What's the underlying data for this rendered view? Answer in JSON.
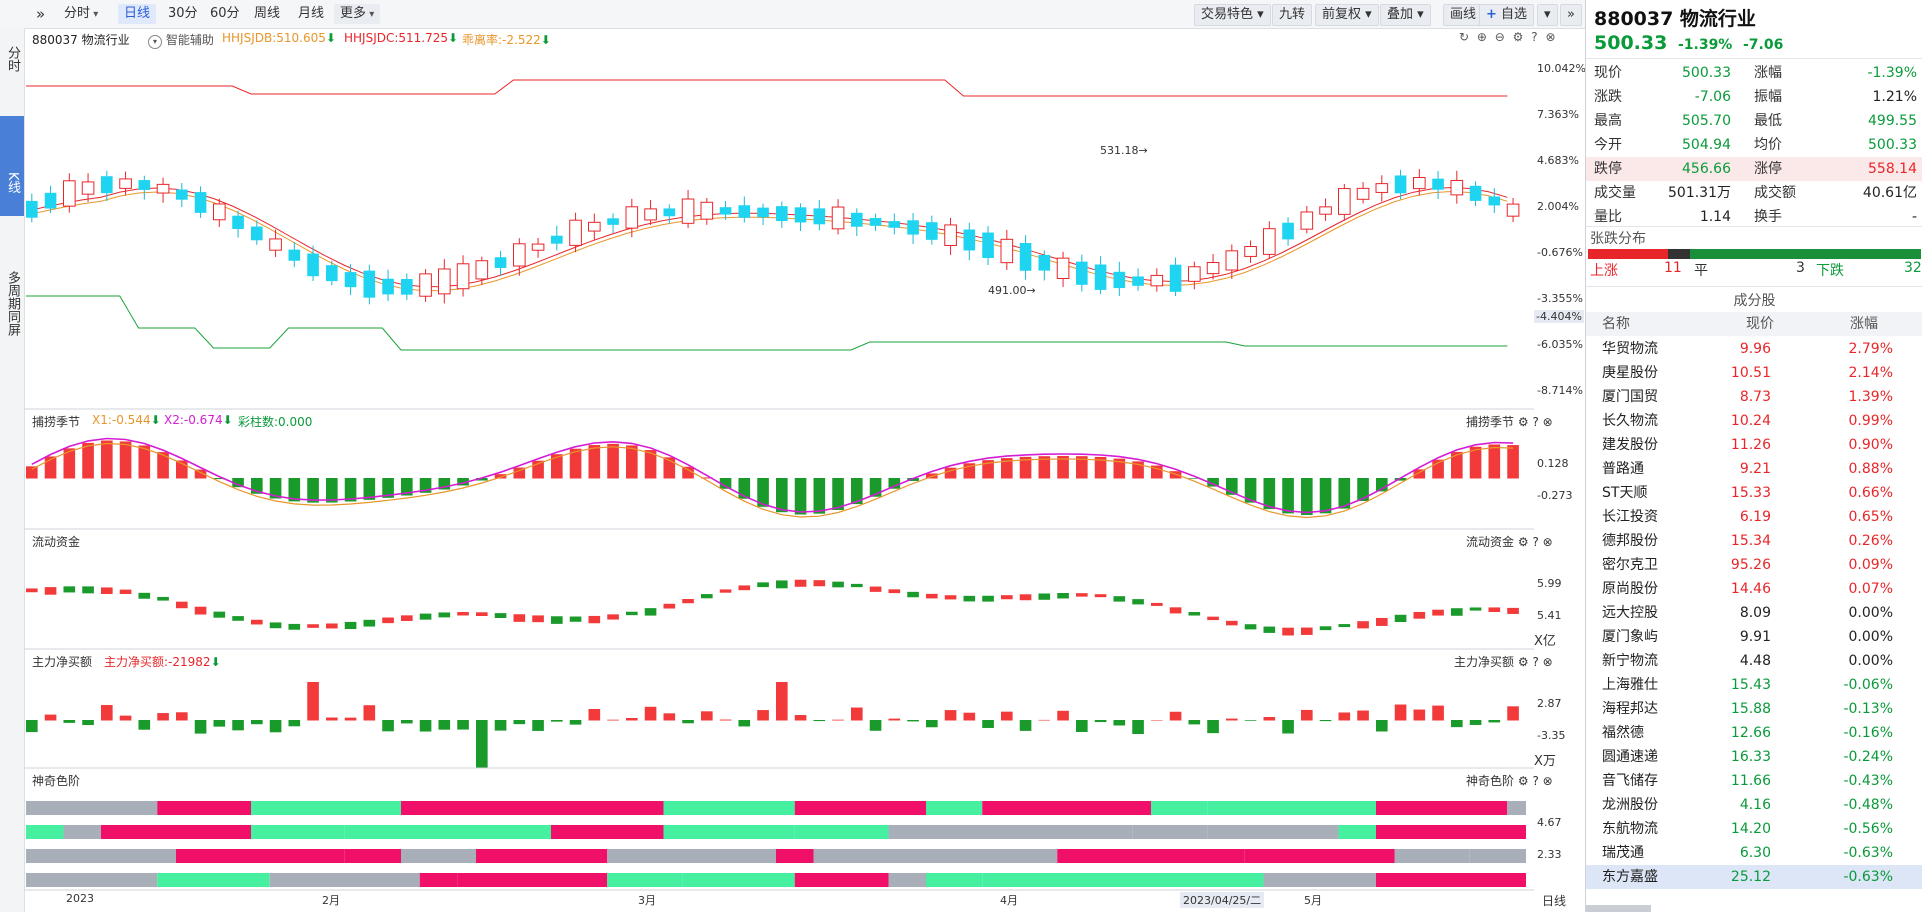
{
  "toolbar": {
    "left_items": [
      "分时",
      "日线",
      "30分",
      "60分",
      "周线",
      "月线",
      "更多"
    ],
    "active": "日线",
    "right_items": [
      "交易特色",
      "九转",
      "前复权",
      "叠加",
      "画线",
      "自选"
    ]
  },
  "left_tabs": [
    "分时",
    "K线",
    "多周期同屏"
  ],
  "main_panel": {
    "code_name": "880037 物流行业",
    "assist": "智能辅助",
    "ind1": "HHJSJDB:510.605",
    "ind2": "HHJSJDC:511.725",
    "ind3": "乖离率:-2.522",
    "y_labels": [
      "10.042%",
      "7.363%",
      "4.683%",
      "2.004%",
      "-0.676%",
      "-3.355%",
      "-4.404%",
      "-6.035%",
      "-8.714%"
    ],
    "high_marker": "531.18",
    "low_marker": "491.00"
  },
  "panel_buhuo": {
    "title": "捕捞季节",
    "x1": "X1:-0.544",
    "x2": "X2:-0.674",
    "caizhu": "彩柱数:0.000",
    "right_title": "捕捞季节",
    "y_labels": [
      "0.128",
      "-0.273"
    ]
  },
  "panel_liudong": {
    "title": "流动资金",
    "right_title": "流动资金",
    "y_labels": [
      "5.99",
      "5.41"
    ],
    "unit": "X亿"
  },
  "panel_zhuli": {
    "title": "主力净买额",
    "value": "主力净买额:-21982",
    "right_title": "主力净买额",
    "y_labels": [
      "2.87",
      "-3.35"
    ],
    "unit": "X万"
  },
  "panel_shenqi": {
    "title": "神奇色阶",
    "right_title": "神奇色阶",
    "y_labels": [
      "4.67",
      "2.33"
    ]
  },
  "x_axis": {
    "labels": [
      "2023",
      "2月",
      "3月",
      "4月",
      "5月"
    ],
    "cursor_date": "2023/04/25/二",
    "period": "日线"
  },
  "quote": {
    "title": "880037 物流行业",
    "price": "500.33",
    "pct": "-1.39%",
    "chg": "-7.06",
    "rows": [
      {
        "l1": "现价",
        "v1": "500.33",
        "c1": "grn",
        "l2": "涨幅",
        "v2": "-1.39%",
        "c2": "grn"
      },
      {
        "l1": "涨跌",
        "v1": "-7.06",
        "c1": "grn",
        "l2": "振幅",
        "v2": "1.21%",
        "c2": "blk"
      },
      {
        "l1": "最高",
        "v1": "505.70",
        "c1": "grn",
        "l2": "最低",
        "v2": "499.55",
        "c2": "grn"
      },
      {
        "l1": "今开",
        "v1": "504.94",
        "c1": "grn",
        "l2": "均价",
        "v2": "500.33",
        "c2": "grn"
      },
      {
        "l1": "跌停",
        "v1": "456.66",
        "c1": "grn",
        "l2": "涨停",
        "v2": "558.14",
        "c2": "red"
      },
      {
        "l1": "成交量",
        "v1": "501.31万",
        "c1": "blk",
        "l2": "成交额",
        "v2": "40.61亿",
        "c2": "blk"
      },
      {
        "l1": "量比",
        "v1": "1.14",
        "c1": "blk",
        "l2": "换手",
        "v2": "-",
        "c2": "blk"
      }
    ],
    "dist_title": "张跌分布",
    "up_label": "上涨",
    "up": "11",
    "flat_label": "平",
    "flat": "3",
    "down_label": "下跌",
    "down": "32"
  },
  "constituents": {
    "title": "成分股",
    "headers": [
      "名称",
      "现价",
      "涨幅"
    ],
    "rows": [
      [
        "华贸物流",
        "9.96",
        "2.79%"
      ],
      [
        "庚星股份",
        "10.51",
        "2.14%"
      ],
      [
        "厦门国贸",
        "8.73",
        "1.39%"
      ],
      [
        "长久物流",
        "10.24",
        "0.99%"
      ],
      [
        "建发股份",
        "11.26",
        "0.90%"
      ],
      [
        "普路通",
        "9.21",
        "0.88%"
      ],
      [
        "ST天顺",
        "15.33",
        "0.66%"
      ],
      [
        "长江投资",
        "6.19",
        "0.65%"
      ],
      [
        "德邦股份",
        "15.34",
        "0.26%"
      ],
      [
        "密尔克卫",
        "95.26",
        "0.09%"
      ],
      [
        "原尚股份",
        "14.46",
        "0.07%"
      ],
      [
        "远大控股",
        "8.09",
        "0.00%"
      ],
      [
        "厦门象屿",
        "9.91",
        "0.00%"
      ],
      [
        "新宁物流",
        "4.48",
        "0.00%"
      ],
      [
        "上海雅仕",
        "15.43",
        "-0.06%"
      ],
      [
        "海程邦达",
        "15.88",
        "-0.13%"
      ],
      [
        "福然德",
        "12.66",
        "-0.16%"
      ],
      [
        "圆通速递",
        "16.33",
        "-0.24%"
      ],
      [
        "音飞储存",
        "11.66",
        "-0.43%"
      ],
      [
        "龙洲股份",
        "4.16",
        "-0.48%"
      ],
      [
        "东航物流",
        "14.20",
        "-0.56%"
      ],
      [
        "瑞茂通",
        "6.30",
        "-0.63%"
      ],
      [
        "东方嘉盛",
        "25.12",
        "-0.63%"
      ]
    ]
  },
  "colors": {
    "up": "#f23a3a",
    "down": "#1aa33a",
    "cyan": "#1fd4f0",
    "pink": "#f0106a",
    "mint": "#46f0a0",
    "gray": "#a9afb8"
  }
}
